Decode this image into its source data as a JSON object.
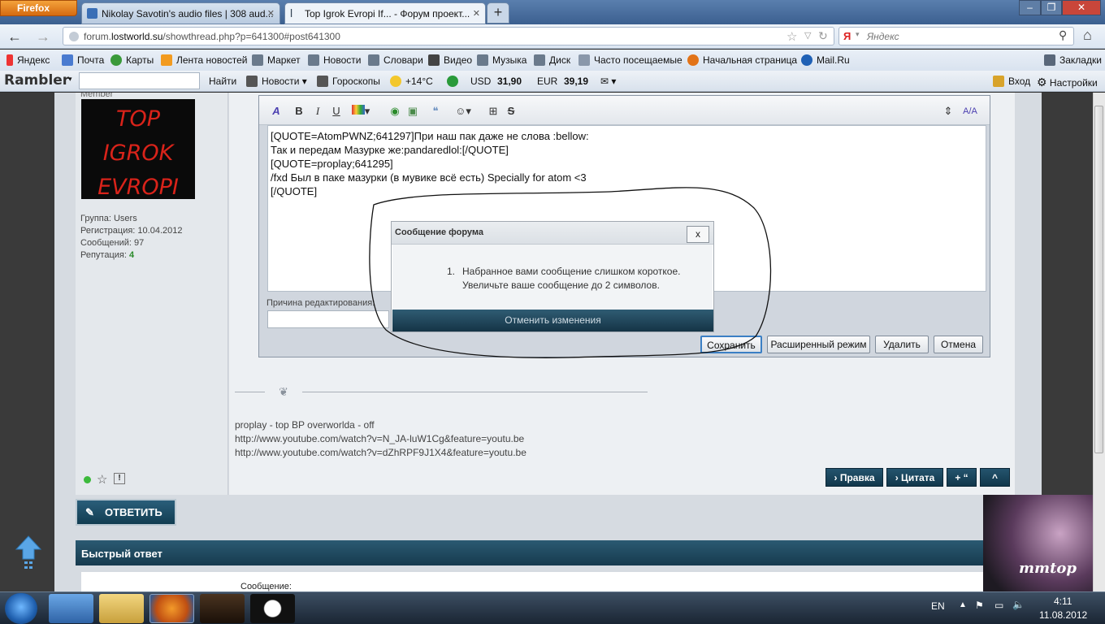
{
  "browser": {
    "menu_label": "Firefox",
    "tabs": [
      {
        "title": "Nikolay Savotin's audio files | 308 aud..."
      },
      {
        "title": "Top Igrok Evropi If... - Форум проект..."
      }
    ],
    "new_tab": "+",
    "url_domain_prefix": "forum.",
    "url_domain": "lostworld.su",
    "url_path": "/showthread.php?p=641300#post641300",
    "search_placeholder": "Яндекс"
  },
  "bookmarks": [
    "Яндекс",
    "Почта",
    "Карты",
    "Лента новостей",
    "Маркет",
    "Новости",
    "Словари",
    "Видео",
    "Музыка",
    "Диск",
    "Часто посещаемые",
    "Начальная страница",
    "Mail.Ru"
  ],
  "bookmarks_right": "Закладки",
  "rambler": {
    "logo": "Rambler",
    "find": "Найти",
    "news": "Новости",
    "horoscope": "Гороскопы",
    "temp": "+14°C",
    "usd_label": "USD",
    "usd": "31,90",
    "eur_label": "EUR",
    "eur": "39,19",
    "login": "Вход",
    "settings": "Настройки"
  },
  "user": {
    "title": "Member",
    "avatar_text": [
      "TOP",
      "IGROK",
      "EVROPI"
    ],
    "group": "Группа: Users",
    "registered": "Регистрация: 10.04.2012",
    "messages": "Сообщений: 97",
    "reputation_label": "Репутация:",
    "reputation": "4"
  },
  "editor": {
    "lines": [
      "[QUOTE=AtomPWNZ;641297]При наш пак даже не слова :bellow:",
      "Так и передам Мазурке же:pandaredlol:[/QUOTE]",
      "[QUOTE=proplay;641295]",
      "/fxd  Был в паке мазурки (в мувике всё есть) Specially for atom <3",
      "[/QUOTE]"
    ],
    "reason_label": "Причина редактирования:",
    "buttons": [
      "Сохранить",
      "Расширенный режим",
      "Удалить",
      "Отмена"
    ]
  },
  "dialog": {
    "title": "Сообщение форума",
    "close": "x",
    "item_number": "1.",
    "message_line1": "Набранное вами сообщение слишком короткое.",
    "message_line2": "Увеличьте ваше сообщение до 2 символов.",
    "button": "Отменить изменения"
  },
  "signature": [
    "proplay - top BP overworlda - off",
    "http://www.youtube.com/watch?v=N_JA-luW1Cg&feature=youtu.be",
    "http://www.youtube.com/watch?v=dZhRPF9J1X4&feature=youtu.be"
  ],
  "post_actions": {
    "edit": "Правка",
    "quote": "Цитата",
    "multiquote": "“",
    "up": "^",
    "report": "!"
  },
  "reply_button": "ОТВЕТИТЬ",
  "quick_reply": {
    "title": "Быстрый ответ",
    "message_label": "Сообщение:"
  },
  "taskbar": {
    "lang": "EN",
    "time": "4:11",
    "date": "11.08.2012"
  },
  "colors": {
    "accent": "#1b4a62",
    "reputation": "#2a8a2a"
  }
}
